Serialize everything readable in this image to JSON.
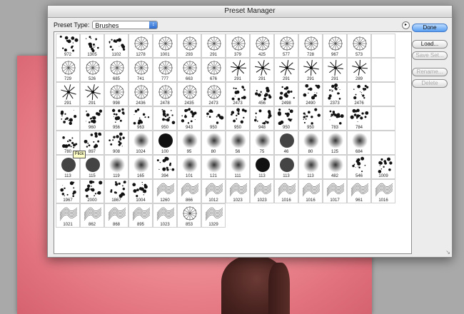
{
  "dialog": {
    "title": "Preset Manager"
  },
  "preset": {
    "label": "Preset Type:",
    "value": "Brushes"
  },
  "buttons": {
    "done": "Done",
    "load": "Load...",
    "save_set": "Save Set...",
    "rename": "Rename...",
    "delete": "Delete"
  },
  "tooltip": "Flick",
  "brushes": [
    {
      "n": "972",
      "t": "splat"
    },
    {
      "n": "1305",
      "t": "splat"
    },
    {
      "n": "1102",
      "t": "splat"
    },
    {
      "n": "1278",
      "t": "ring"
    },
    {
      "n": "1001",
      "t": "ring"
    },
    {
      "n": "293",
      "t": "ring"
    },
    {
      "n": "291",
      "t": "ring"
    },
    {
      "n": "379",
      "t": "ring"
    },
    {
      "n": "425",
      "t": "ring"
    },
    {
      "n": "577",
      "t": "ring"
    },
    {
      "n": "728",
      "t": "ring"
    },
    {
      "n": "967",
      "t": "ring"
    },
    {
      "n": "573",
      "t": "ring"
    },
    {
      "n": "",
      "t": "empty"
    },
    {
      "n": "729",
      "t": "ring"
    },
    {
      "n": "526",
      "t": "ring"
    },
    {
      "n": "685",
      "t": "ring"
    },
    {
      "n": "741",
      "t": "ring"
    },
    {
      "n": "777",
      "t": "ring"
    },
    {
      "n": "663",
      "t": "ring"
    },
    {
      "n": "676",
      "t": "ring"
    },
    {
      "n": "291",
      "t": "star"
    },
    {
      "n": "291",
      "t": "star"
    },
    {
      "n": "291",
      "t": "star"
    },
    {
      "n": "291",
      "t": "star"
    },
    {
      "n": "291",
      "t": "star"
    },
    {
      "n": "289",
      "t": "star"
    },
    {
      "n": "",
      "t": "empty"
    },
    {
      "n": "291",
      "t": "star"
    },
    {
      "n": "291",
      "t": "star"
    },
    {
      "n": "998",
      "t": "ring"
    },
    {
      "n": "2436",
      "t": "ring"
    },
    {
      "n": "2478",
      "t": "ring"
    },
    {
      "n": "2435",
      "t": "ring"
    },
    {
      "n": "2473",
      "t": "ring"
    },
    {
      "n": "2473",
      "t": "splat"
    },
    {
      "n": "456",
      "t": "splat"
    },
    {
      "n": "2498",
      "t": "splat"
    },
    {
      "n": "2490",
      "t": "splat"
    },
    {
      "n": "2373",
      "t": "splat"
    },
    {
      "n": "2476",
      "t": "splat"
    },
    {
      "n": "",
      "t": "empty"
    },
    {
      "n": "",
      "t": "splat"
    },
    {
      "n": "960",
      "t": "splat"
    },
    {
      "n": "956",
      "t": "splat"
    },
    {
      "n": "963",
      "t": "splat"
    },
    {
      "n": "950",
      "t": "splat"
    },
    {
      "n": "943",
      "t": "splat"
    },
    {
      "n": "950",
      "t": "splat"
    },
    {
      "n": "950",
      "t": "splat"
    },
    {
      "n": "948",
      "t": "splat"
    },
    {
      "n": "950",
      "t": "splat"
    },
    {
      "n": "950",
      "t": "splat"
    },
    {
      "n": "783",
      "t": "splat"
    },
    {
      "n": "784",
      "t": "splat"
    },
    {
      "n": "",
      "t": "empty"
    },
    {
      "n": "780",
      "t": "splat"
    },
    {
      "n": "897",
      "t": "splat"
    },
    {
      "n": "908",
      "t": "splat"
    },
    {
      "n": "1024",
      "t": "soft"
    },
    {
      "n": "100",
      "t": "hard"
    },
    {
      "n": "95",
      "t": "soft"
    },
    {
      "n": "80",
      "t": "soft"
    },
    {
      "n": "56",
      "t": "soft"
    },
    {
      "n": "75",
      "t": "soft"
    },
    {
      "n": "46",
      "t": "hard"
    },
    {
      "n": "80",
      "t": "soft"
    },
    {
      "n": "125",
      "t": "soft"
    },
    {
      "n": "684",
      "t": "soft"
    },
    {
      "n": "",
      "t": "empty"
    },
    {
      "n": "113",
      "t": "hard"
    },
    {
      "n": "115",
      "t": "hard"
    },
    {
      "n": "119",
      "t": "soft"
    },
    {
      "n": "165",
      "t": "soft"
    },
    {
      "n": "394",
      "t": "splat"
    },
    {
      "n": "101",
      "t": "soft"
    },
    {
      "n": "121",
      "t": "soft"
    },
    {
      "n": "111",
      "t": "soft"
    },
    {
      "n": "113",
      "t": "hard"
    },
    {
      "n": "113",
      "t": "hard"
    },
    {
      "n": "113",
      "t": "soft"
    },
    {
      "n": "482",
      "t": "soft"
    },
    {
      "n": "546",
      "t": "splat"
    },
    {
      "n": "1009",
      "t": "splat"
    },
    {
      "n": "1967",
      "t": "splat"
    },
    {
      "n": "2000",
      "t": "splat"
    },
    {
      "n": "1867",
      "t": "splat"
    },
    {
      "n": "1004",
      "t": "splat"
    },
    {
      "n": "1260",
      "t": "line"
    },
    {
      "n": "866",
      "t": "line"
    },
    {
      "n": "1012",
      "t": "line"
    },
    {
      "n": "1023",
      "t": "line"
    },
    {
      "n": "1023",
      "t": "line"
    },
    {
      "n": "1016",
      "t": "line"
    },
    {
      "n": "1016",
      "t": "line"
    },
    {
      "n": "1017",
      "t": "line"
    },
    {
      "n": "961",
      "t": "line"
    },
    {
      "n": "1016",
      "t": "line"
    },
    {
      "n": "1021",
      "t": "line"
    },
    {
      "n": "862",
      "t": "line"
    },
    {
      "n": "868",
      "t": "line"
    },
    {
      "n": "895",
      "t": "line"
    },
    {
      "n": "1023",
      "t": "line"
    },
    {
      "n": "853",
      "t": "ring"
    },
    {
      "n": "1329",
      "t": "line"
    }
  ],
  "icons": {
    "select_arrow": "chevron-updown-icon",
    "menu": "flyout-menu-icon",
    "grip": "resize-grip-icon"
  }
}
